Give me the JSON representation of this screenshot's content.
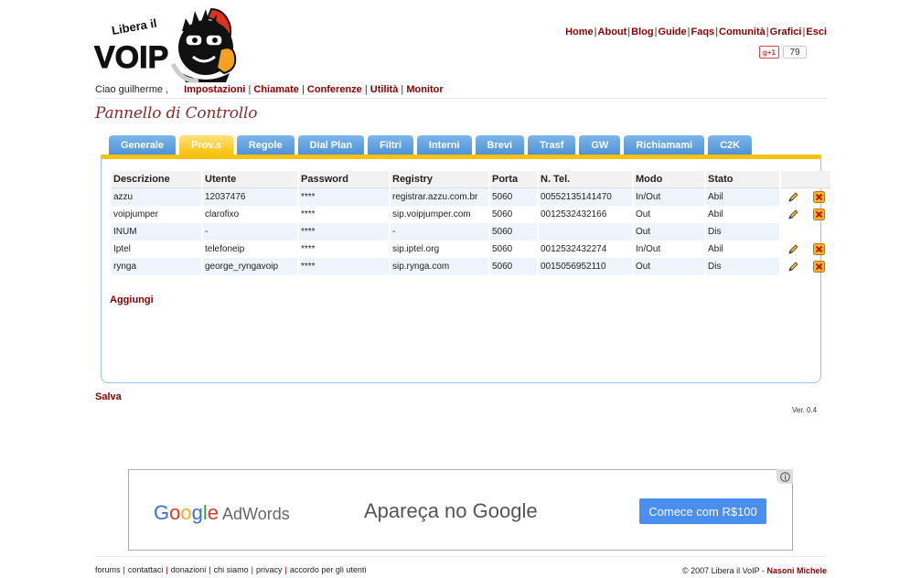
{
  "header": {
    "logo_text": "Libera il VoIP",
    "nav": [
      "Home",
      "About",
      "Blog",
      "Guide",
      "Faqs",
      "Comunità",
      "Grafici",
      "Esci"
    ],
    "gplus_label": "+1",
    "gplus_count": "79"
  },
  "userbar": {
    "greeting": "Ciao guilherme ,",
    "menu": [
      "Impostazioni",
      "Chiamate",
      "Conferenze",
      "Utilità",
      "Monitor"
    ]
  },
  "page_title": "Pannello di Controllo",
  "tabs": [
    "Generale",
    "Prov.s",
    "Regole",
    "Dial Plan",
    "Filtri",
    "Interni",
    "Brevi",
    "Trasf",
    "GW",
    "Richiamami",
    "C2K"
  ],
  "active_tab": "Prov.s",
  "table": {
    "columns": [
      "Descrizione",
      "Utente",
      "Password",
      "Registry",
      "Porta",
      "N. Tel.",
      "Modo",
      "Stato"
    ],
    "rows": [
      {
        "descrizione": "azzu",
        "utente": "12037476",
        "password": "****",
        "registry": "registrar.azzu.com.br",
        "porta": "5060",
        "tel": "00552135141470",
        "modo": "In/Out",
        "stato": "Abil",
        "editable": true
      },
      {
        "descrizione": "voipjumper",
        "utente": "clarofixo",
        "password": "****",
        "registry": "sip.voipjumper.com",
        "porta": "5060",
        "tel": "0012532432166",
        "modo": "Out",
        "stato": "Abil",
        "editable": true
      },
      {
        "descrizione": "INUM",
        "utente": "-",
        "password": "****",
        "registry": "-",
        "porta": "5060",
        "tel": "",
        "modo": "Out",
        "stato": "Dis",
        "editable": false
      },
      {
        "descrizione": "Iptel",
        "utente": "telefoneip",
        "password": "****",
        "registry": "sip.iptel.org",
        "porta": "5060",
        "tel": "0012532432274",
        "modo": "In/Out",
        "stato": "Abil",
        "editable": true
      },
      {
        "descrizione": "rynga",
        "utente": "george_ryngavoip",
        "password": "****",
        "registry": "sip.rynga.com",
        "porta": "5060",
        "tel": "0015056952110",
        "modo": "Out",
        "stato": "Dis",
        "editable": true
      }
    ]
  },
  "actions": {
    "add": "Aggiungi",
    "save": "Salva"
  },
  "version": "Ver. 0.4",
  "ad": {
    "brand_google": "Google",
    "brand_adwords": "AdWords",
    "headline": "Apareça no Google",
    "cta": "Comece com R$100",
    "colors": {
      "cta": "#4a8ef0"
    }
  },
  "footer": {
    "links": [
      "forums",
      "contattaci",
      "donazioni",
      "chi siamo",
      "privacy",
      "accordo per gli utenti"
    ],
    "copyright": "© 2007 Libera il VoIP - ",
    "author": "Nasoni Michele"
  },
  "colors": {
    "link": "#8b0000",
    "tab": "#5b9de0",
    "tab_active": "#f7c20e"
  }
}
